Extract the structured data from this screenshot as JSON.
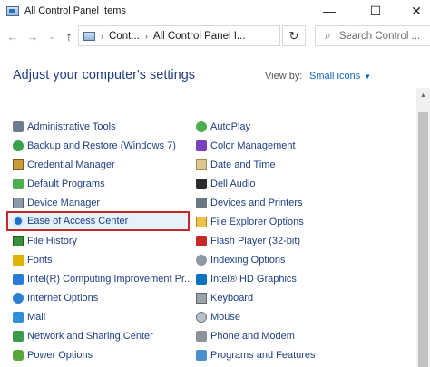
{
  "window": {
    "title": "All Control Panel Items",
    "minimize_glyph": "—",
    "maximize_glyph": "☐",
    "close_glyph": "✕"
  },
  "nav": {
    "back_glyph": "←",
    "forward_glyph": "→",
    "recent_glyph": "⌄",
    "up_glyph": "↑"
  },
  "address": {
    "crumb1": "Cont...",
    "crumb2": "All Control Panel I...",
    "separator": "›",
    "dropdown_glyph": "⌄",
    "refresh_glyph": "↻"
  },
  "search": {
    "placeholder": "Search Control ...",
    "icon": "search-icon",
    "glyph": "⌕"
  },
  "header": {
    "title": "Adjust your computer's settings",
    "view_by_label": "View by:",
    "view_by_value": "Small icons",
    "caret": "▼"
  },
  "scrollbar": {
    "up_glyph": "▲"
  },
  "items_left": [
    {
      "label": "Administrative Tools",
      "icon": "admin-tools-icon"
    },
    {
      "label": "Backup and Restore (Windows 7)",
      "icon": "backup-restore-icon"
    },
    {
      "label": "Credential Manager",
      "icon": "credential-manager-icon"
    },
    {
      "label": "Default Programs",
      "icon": "default-programs-icon"
    },
    {
      "label": "Device Manager",
      "icon": "device-manager-icon"
    },
    {
      "label": "Ease of Access Center",
      "icon": "ease-of-access-icon",
      "selected": true
    },
    {
      "label": "File History",
      "icon": "file-history-icon"
    },
    {
      "label": "Fonts",
      "icon": "fonts-icon"
    },
    {
      "label": "Intel(R) Computing Improvement Pr...",
      "icon": "intel-icon"
    },
    {
      "label": "Internet Options",
      "icon": "internet-options-icon"
    },
    {
      "label": "Mail",
      "icon": "mail-icon"
    },
    {
      "label": "Network and Sharing Center",
      "icon": "network-sharing-icon"
    },
    {
      "label": "Power Options",
      "icon": "power-options-icon"
    }
  ],
  "items_right": [
    {
      "label": "AutoPlay",
      "icon": "autoplay-icon"
    },
    {
      "label": "Color Management",
      "icon": "color-management-icon"
    },
    {
      "label": "Date and Time",
      "icon": "date-time-icon"
    },
    {
      "label": "Dell Audio",
      "icon": "dell-audio-icon"
    },
    {
      "label": "Devices and Printers",
      "icon": "devices-printers-icon"
    },
    {
      "label": "File Explorer Options",
      "icon": "file-explorer-options-icon"
    },
    {
      "label": "Flash Player (32-bit)",
      "icon": "flash-player-icon"
    },
    {
      "label": "Indexing Options",
      "icon": "indexing-options-icon"
    },
    {
      "label": "Intel® HD Graphics",
      "icon": "intel-hd-graphics-icon"
    },
    {
      "label": "Keyboard",
      "icon": "keyboard-icon"
    },
    {
      "label": "Mouse",
      "icon": "mouse-icon"
    },
    {
      "label": "Phone and Modem",
      "icon": "phone-modem-icon"
    },
    {
      "label": "Programs and Features",
      "icon": "programs-features-icon"
    }
  ],
  "colors": {
    "link": "#1f3f84",
    "heading": "#1f3f84",
    "accent": "#1565c0",
    "selection_border": "#c62828",
    "selection_fill": "#e5f1fb"
  }
}
